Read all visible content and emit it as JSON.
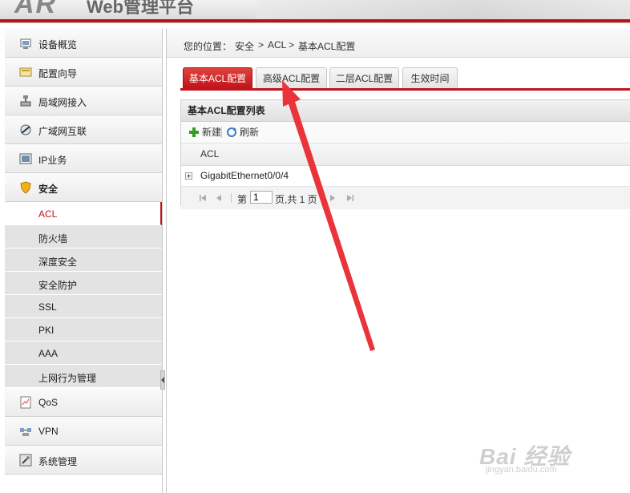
{
  "header": {
    "logo": "AR",
    "title": "Web管理平台"
  },
  "sidebar": {
    "items_top": [
      {
        "label": "设备概览",
        "icon": "device-overview-icon"
      },
      {
        "label": "配置向导",
        "icon": "wizard-icon"
      },
      {
        "label": "局域网接入",
        "icon": "lan-icon"
      },
      {
        "label": "广域网互联",
        "icon": "wan-icon"
      },
      {
        "label": "IP业务",
        "icon": "ip-icon"
      },
      {
        "label": "安全",
        "icon": "shield-icon"
      }
    ],
    "sub_items": [
      {
        "label": "ACL"
      },
      {
        "label": "防火墙"
      },
      {
        "label": "深度安全"
      },
      {
        "label": "安全防护"
      },
      {
        "label": "SSL"
      },
      {
        "label": "PKI"
      },
      {
        "label": "AAA"
      },
      {
        "label": "上网行为管理"
      }
    ],
    "items_bottom": [
      {
        "label": "QoS",
        "icon": "qos-icon"
      },
      {
        "label": "VPN",
        "icon": "vpn-icon"
      },
      {
        "label": "系统管理",
        "icon": "system-icon"
      }
    ]
  },
  "breadcrumb": {
    "prefix": "您的位置：",
    "parts": [
      "安全",
      "ACL",
      "基本ACL配置"
    ],
    "sep": ">"
  },
  "tabs": [
    "基本ACL配置",
    "高级ACL配置",
    "二层ACL配置",
    "生效时间"
  ],
  "panel": {
    "title": "基本ACL配置列表",
    "toolbar": {
      "new_label": "新建",
      "refresh_label": "刷新"
    },
    "column": "ACL",
    "rows": [
      "GigabitEthernet0/0/4"
    ],
    "pager": {
      "page_prefix": "第",
      "page_value": "1",
      "page_suffix": "页,共 1 页"
    }
  },
  "watermark": {
    "big": "Bai 经验",
    "small": "jingyan.baidu.com"
  },
  "colors": {
    "accent": "#c0151e",
    "arrow": "#e8343a"
  }
}
